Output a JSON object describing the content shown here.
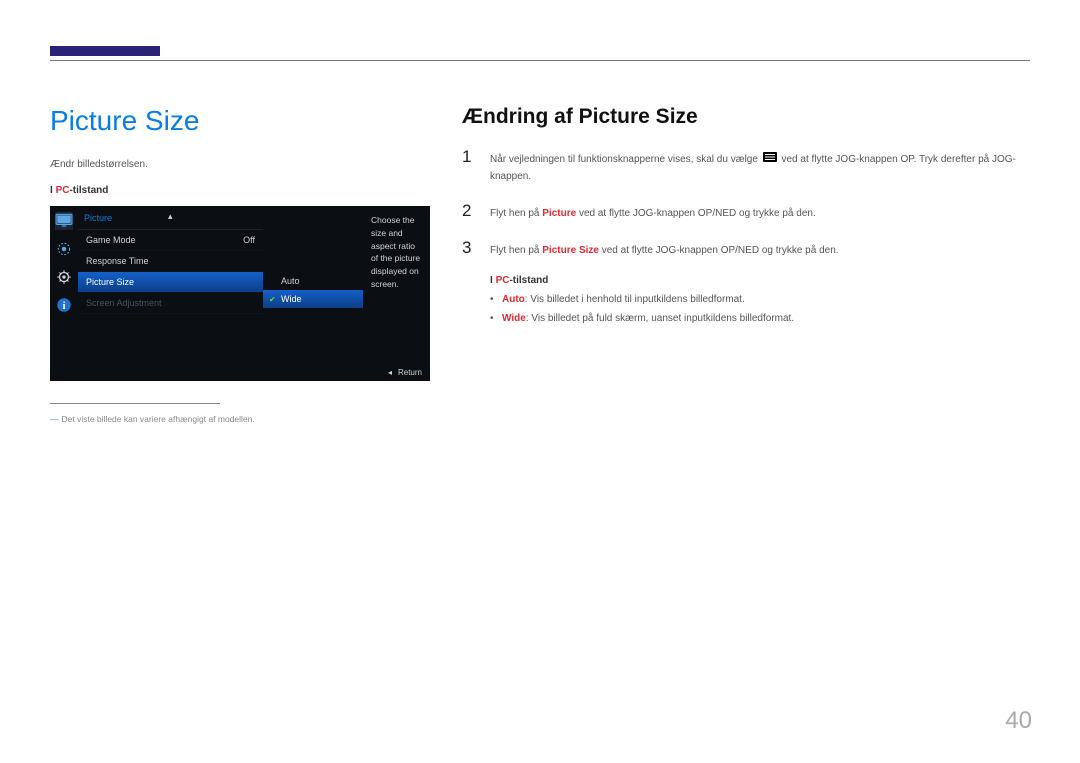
{
  "topHeading": "Picture Size",
  "leftIntro": "Ændr billedstørrelsen.",
  "sectionLabel": {
    "prefix": "I ",
    "hl": "PC",
    "suffix": "-tilstand"
  },
  "osd": {
    "title": "Picture",
    "rows": [
      {
        "label": "Game Mode",
        "value": "Off",
        "selected": false
      },
      {
        "label": "Response Time",
        "value": "",
        "selected": false
      },
      {
        "label": "Picture Size",
        "value": "",
        "selected": true
      },
      {
        "label": "Screen Adjustment",
        "value": "",
        "selected": false,
        "disabled": true
      }
    ],
    "subItems": [
      {
        "label": "Auto",
        "selected": false,
        "checked": false
      },
      {
        "label": "Wide",
        "selected": true,
        "checked": true
      }
    ],
    "description": "Choose the size and aspect ratio of the picture displayed on screen.",
    "returnLabel": "Return"
  },
  "footnote": "Det viste billede kan variere afhængigt af modellen.",
  "rightHeading": "Ændring af Picture Size",
  "steps": [
    {
      "num": "1",
      "parts": [
        {
          "t": "Når vejledningen til funktionsknapperne vises, skal du vælge "
        },
        {
          "icon": "menu"
        },
        {
          "t": " ved at flytte JOG-knappen OP. Tryk derefter på JOG-knappen."
        }
      ]
    },
    {
      "num": "2",
      "parts": [
        {
          "t": "Flyt hen på "
        },
        {
          "hl": "Picture"
        },
        {
          "t": " ved at flytte JOG-knappen OP/NED og trykke på den."
        }
      ]
    },
    {
      "num": "3",
      "parts": [
        {
          "t": "Flyt hen på "
        },
        {
          "hl": "Picture Size"
        },
        {
          "t": " ved at flytte JOG-knappen OP/NED og trykke på den."
        }
      ]
    }
  ],
  "bullets": [
    {
      "hl": "Auto",
      "t": ": Vis billedet i henhold til inputkildens billedformat."
    },
    {
      "hl": "Wide",
      "t": ": Vis billedet på fuld skærm, uanset inputkildens billedformat."
    }
  ],
  "pageNumber": "40"
}
